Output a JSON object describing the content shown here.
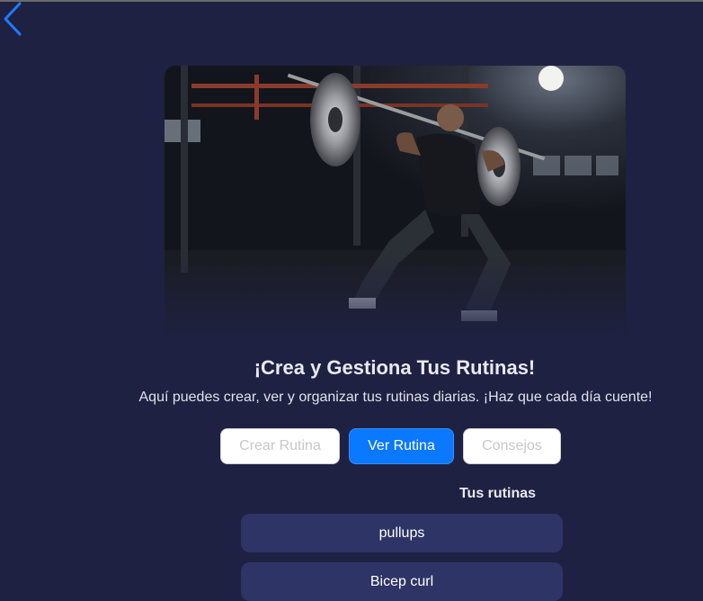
{
  "header": {
    "back_icon": "chevron-left-icon",
    "back_color": "#1e7bff"
  },
  "hero": {
    "image": "gym-lunge-barbell-photo"
  },
  "main": {
    "title": "¡Crea y Gestiona Tus Rutinas!",
    "subtitle": "Aquí puedes crear, ver y organizar tus rutinas diarias. ¡Haz que cada día cuente!"
  },
  "tabs": {
    "create_label": "Crear Rutina",
    "view_label": "Ver Rutina",
    "tips_label": "Consejos",
    "active": "Ver Rutina",
    "active_color": "#0a78ff"
  },
  "routines": {
    "heading": "Tus rutinas",
    "items": [
      {
        "name": "pullups"
      },
      {
        "name": "Bicep curl"
      }
    ]
  }
}
